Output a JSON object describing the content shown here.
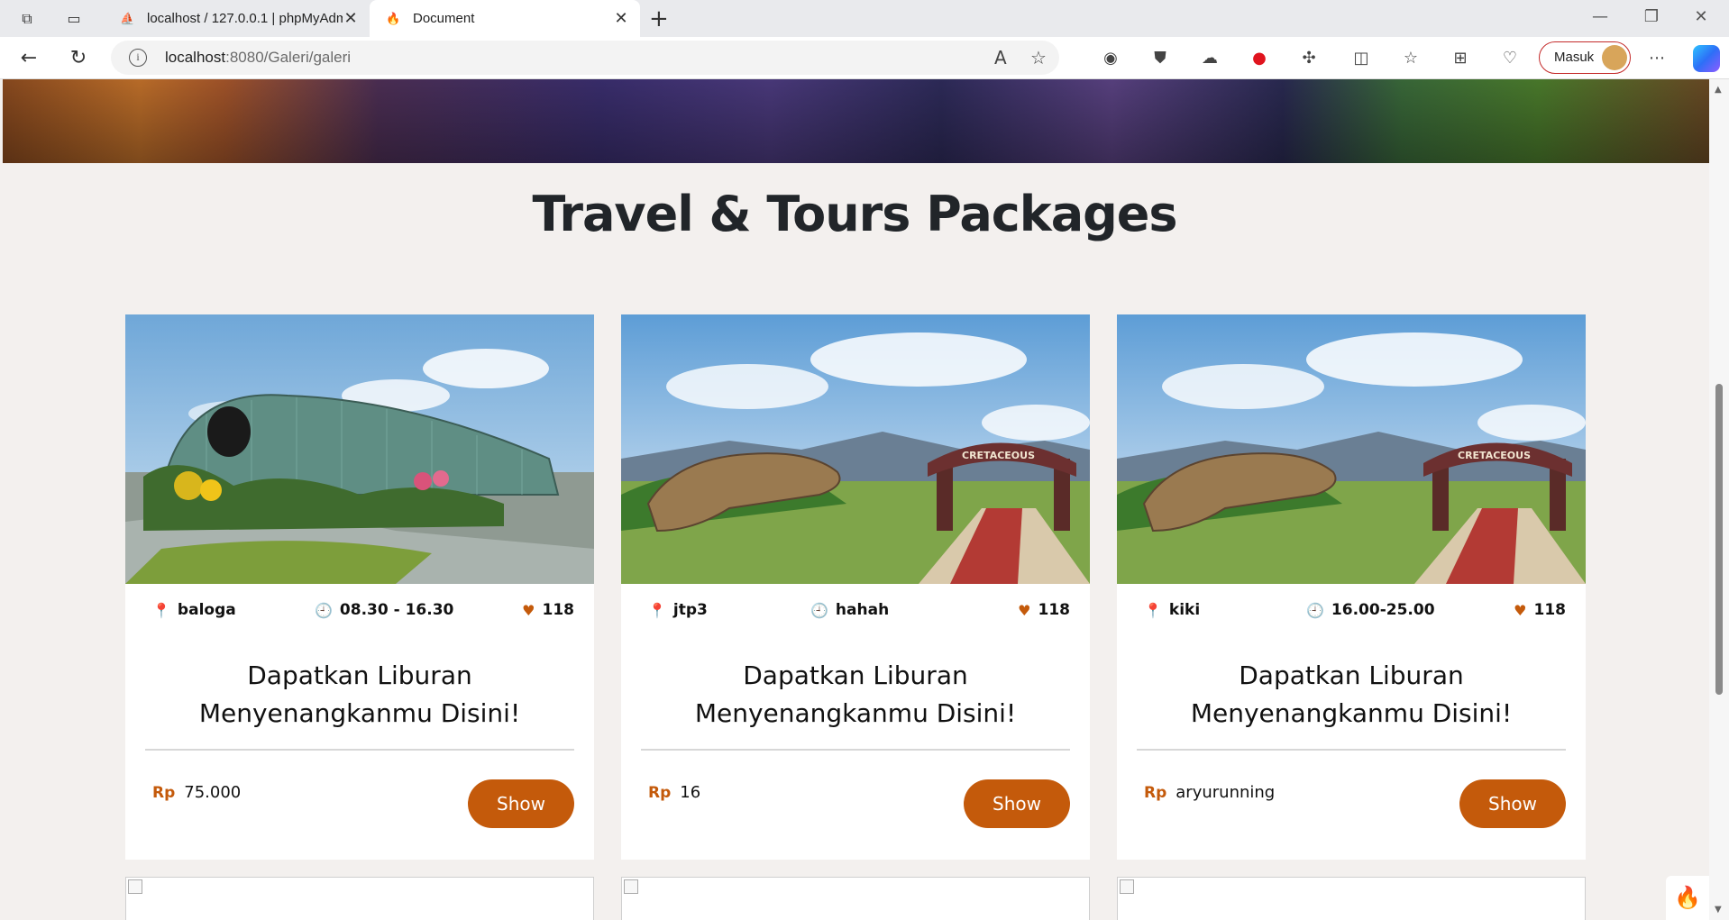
{
  "browser": {
    "tabs": [
      {
        "title": "localhost / 127.0.0.1 | phpMyAdmin",
        "active": false
      },
      {
        "title": "Document",
        "active": true
      }
    ],
    "address": {
      "host": "localhost",
      "path": ":8080/Galeri/galeri"
    },
    "profile_label": "Masuk"
  },
  "page": {
    "section_title": "Travel & Tours Packages",
    "cards": [
      {
        "location": "baloga",
        "time": "08.30 - 16.30",
        "likes": "118",
        "title": "Dapatkan Liburan Menyenangkanmu Disini!",
        "currency": "Rp",
        "price": "75.000",
        "button": "Show"
      },
      {
        "location": "jtp3",
        "time": "hahah",
        "likes": "118",
        "title": "Dapatkan Liburan Menyenangkanmu Disini!",
        "currency": "Rp",
        "price": "16",
        "button": "Show"
      },
      {
        "location": "kiki",
        "time": "16.00-25.00",
        "likes": "118",
        "title": "Dapatkan Liburan Menyenangkanmu Disini!",
        "currency": "Rp",
        "price": "aryurunning",
        "button": "Show"
      }
    ]
  },
  "colors": {
    "accent": "#c45a0b",
    "page_bg": "#f3f0ee",
    "title": "#212529"
  }
}
